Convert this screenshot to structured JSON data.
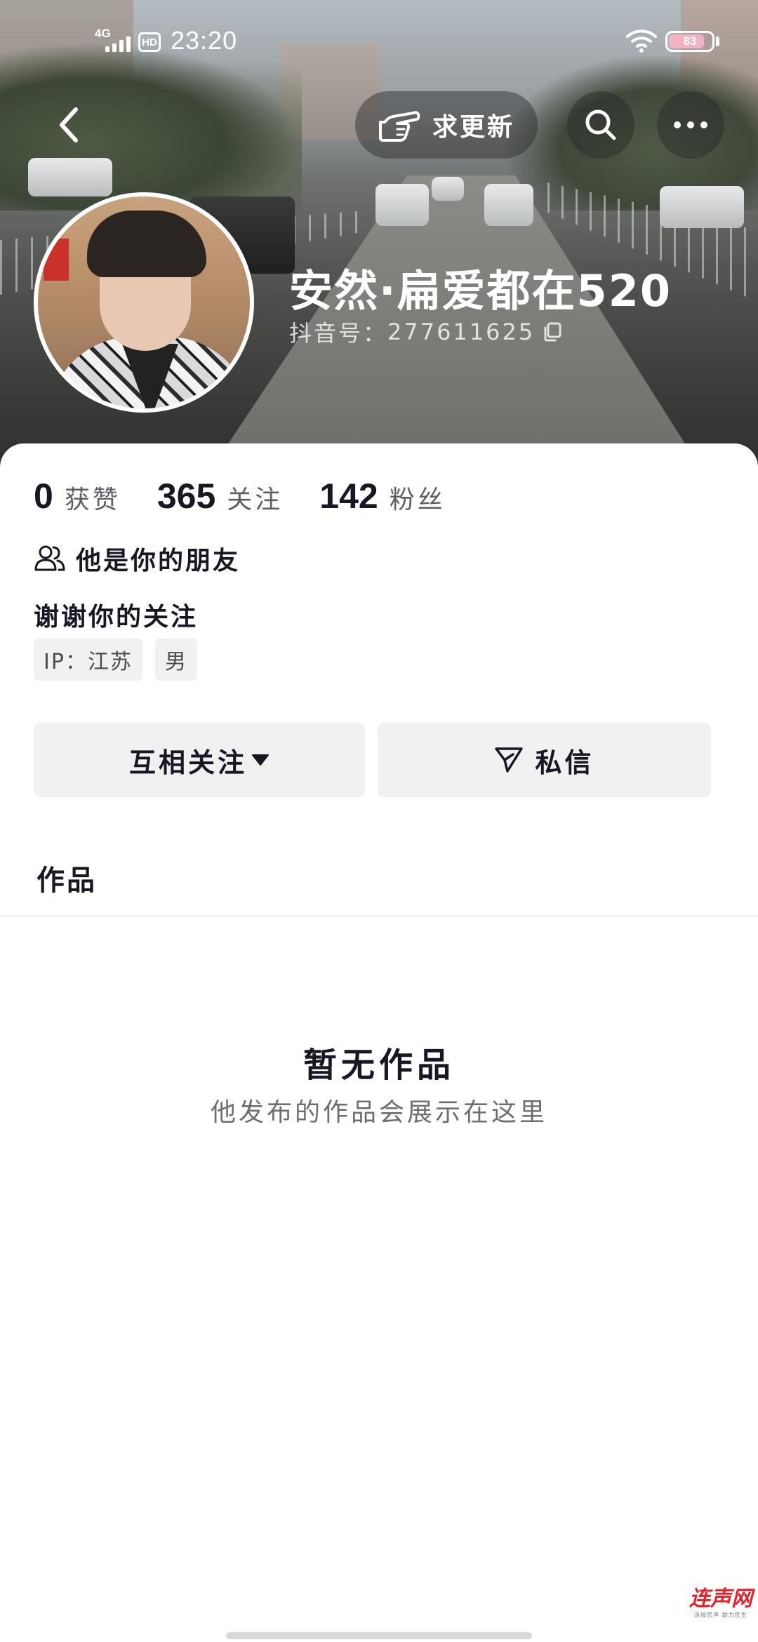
{
  "status_bar": {
    "network": "4G",
    "hd": "HD",
    "time": "23:20",
    "battery_percent": 83,
    "battery_label": "83"
  },
  "nav": {
    "request_update_label": "求更新",
    "back_icon": "chevron-left-icon",
    "search_icon": "search-icon",
    "more_icon": "more-dots-icon",
    "request_update_icon": "pointing-hand-icon"
  },
  "profile": {
    "display_name": "安然·扁爱都在520",
    "douyin_id_label": "抖音号：",
    "douyin_id": "277611625"
  },
  "stats": [
    {
      "value": "0",
      "label": "获赞"
    },
    {
      "value": "365",
      "label": "关注"
    },
    {
      "value": "142",
      "label": "粉丝"
    }
  ],
  "relationship": "他是你的朋友",
  "bio": "谢谢你的关注",
  "tags": [
    {
      "label": "IP：江苏"
    },
    {
      "label": "男"
    }
  ],
  "actions": {
    "follow_label": "互相关注",
    "message_label": "私信"
  },
  "works": {
    "tab_label": "作品",
    "empty_title": "暂无作品",
    "empty_desc": "他发布的作品会展示在这里"
  },
  "watermark": {
    "main": "连声网",
    "sub": "连接民声 助力民生"
  },
  "colors": {
    "text_primary": "#161823",
    "text_secondary": "#5e5f66",
    "button_bg": "#f1f1f2",
    "watermark_red": "#e0242b"
  }
}
